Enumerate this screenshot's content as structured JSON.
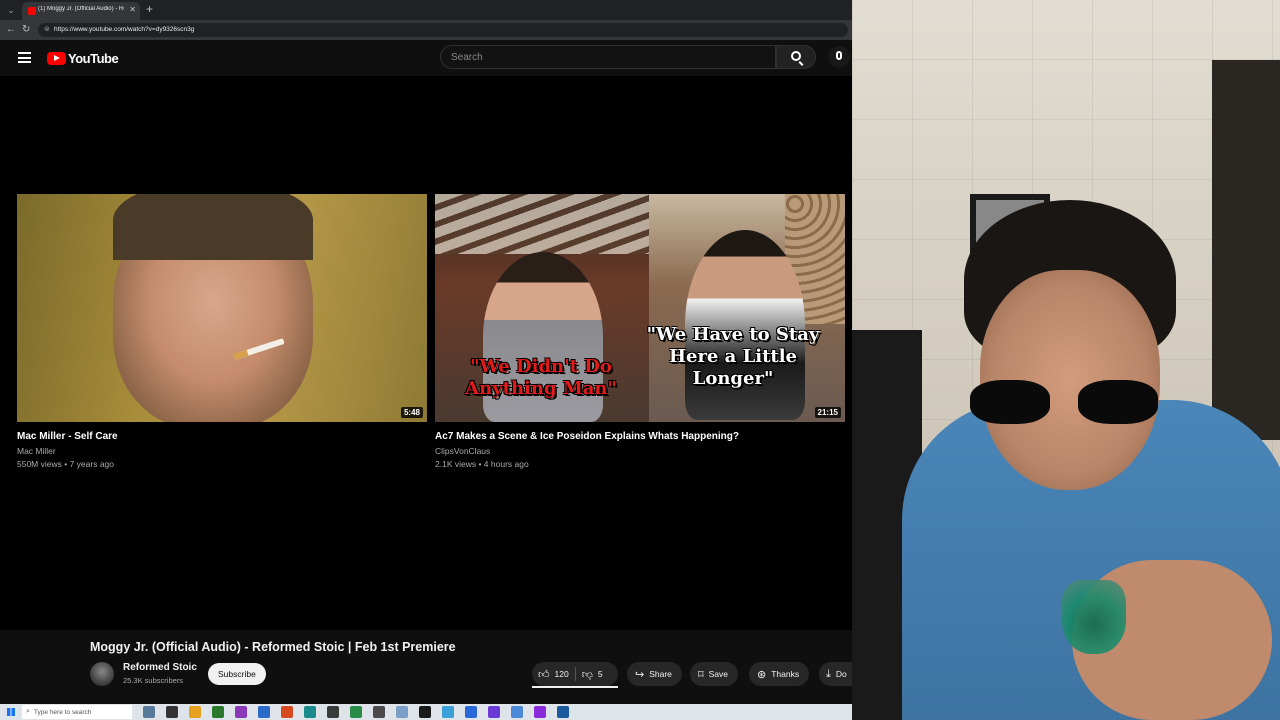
{
  "browser": {
    "tab_title": "(1) Moggy Jr. (Official Audio) - Re",
    "url": "https://www.youtube.com/watch?v=dy9326scn3g"
  },
  "youtube": {
    "logo_text": "YouTube",
    "search": {
      "placeholder": "Search"
    }
  },
  "endscreen": {
    "cards": [
      {
        "title": "Mac Miller - Self Care",
        "channel": "Mac Miller",
        "meta": "550M views • 7 years ago",
        "duration": "5:48"
      },
      {
        "title": "Ac7 Makes a Scene & Ice Poseidon Explains Whats Happening?",
        "channel": "ClipsVonClaus",
        "meta": "2.1K views • 4 hours ago",
        "duration": "21:15",
        "caption_red": [
          "\"We Didn't Do",
          "Anything Man\""
        ],
        "caption_white": [
          "\"We Have to Stay",
          "Here a Little",
          "Longer\""
        ]
      }
    ]
  },
  "watch": {
    "title": "Moggy Jr. (Official Audio) - Reformed Stoic | Feb 1st Premiere",
    "owner": {
      "name": "Reformed Stoic",
      "subscribers": "25.3K subscribers"
    },
    "subscribe_label": "Subscribe",
    "likes": "120",
    "dislikes": "5",
    "share_label": "Share",
    "save_label": "Save",
    "thanks_label": "Thanks",
    "download_label": "Do"
  },
  "taskbar": {
    "search_placeholder": "Type here to search",
    "icon_colors": [
      "#5a7a9a",
      "#333333",
      "#e8a020",
      "#2b7a2b",
      "#8a3ab8",
      "#2a6ac8",
      "#d84a20",
      "#1a8a8a",
      "#3a3a3a",
      "#2a8a4a",
      "#4a4a4a",
      "#7aa0c8",
      "#1a1a1a",
      "#3aa0d8",
      "#2a6ad8",
      "#6a3ad8",
      "#4a8ad8",
      "#8a2ad8",
      "#1a5a9a"
    ]
  },
  "colors": {
    "youtube_red": "#ff0000",
    "page_bg": "#0f0f0f",
    "caption_red": "#e21a1a"
  }
}
